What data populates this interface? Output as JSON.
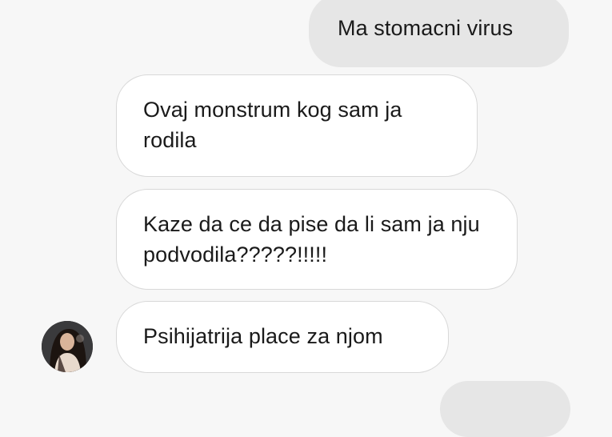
{
  "conversation": {
    "messages": [
      {
        "direction": "outgoing",
        "text": "Ma stomacni virus"
      },
      {
        "direction": "incoming",
        "text": "Ovaj monstrum kog sam ja rodila"
      },
      {
        "direction": "incoming",
        "text": "Kaze da ce da pise da li sam ja nju podvodila?????!!!!!"
      },
      {
        "direction": "incoming",
        "text": "Psihijatrija place za njom"
      },
      {
        "direction": "outgoing",
        "text": ""
      }
    ],
    "contact_avatar_icon": "contact-avatar-photo"
  },
  "colors": {
    "background": "#f7f7f7",
    "outgoing_bubble": "#e6e6e6",
    "incoming_bubble": "#ffffff",
    "incoming_border": "#d8d8d8",
    "text": "#1a1a1a"
  }
}
